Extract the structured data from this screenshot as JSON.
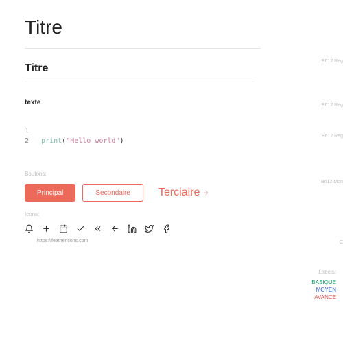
{
  "headings": {
    "h1": "Titre",
    "h2": "Titre"
  },
  "body_text": "texte",
  "code": {
    "line1_num": "1",
    "line2_num": "2",
    "fn": "print",
    "open": "(",
    "str": "\"Hello world\"",
    "close": ")"
  },
  "sections": {
    "buttons": "Boutons:",
    "icons": "Icons:",
    "labels": "Labels:"
  },
  "buttons": {
    "primary": "Principal",
    "secondary": "Secondaire",
    "tertiary": "Terciaire"
  },
  "labels": {
    "basique": "BASIQUE",
    "moyen": "MOYEN",
    "avance": "AVANCE"
  },
  "icons_link": "https://feathericons.com",
  "edge_notes": {
    "n1": "B612 Reg",
    "n2": "B612 Reg",
    "n3": "B612 Reg",
    "n4": "B612 Mon",
    "c": "C"
  }
}
